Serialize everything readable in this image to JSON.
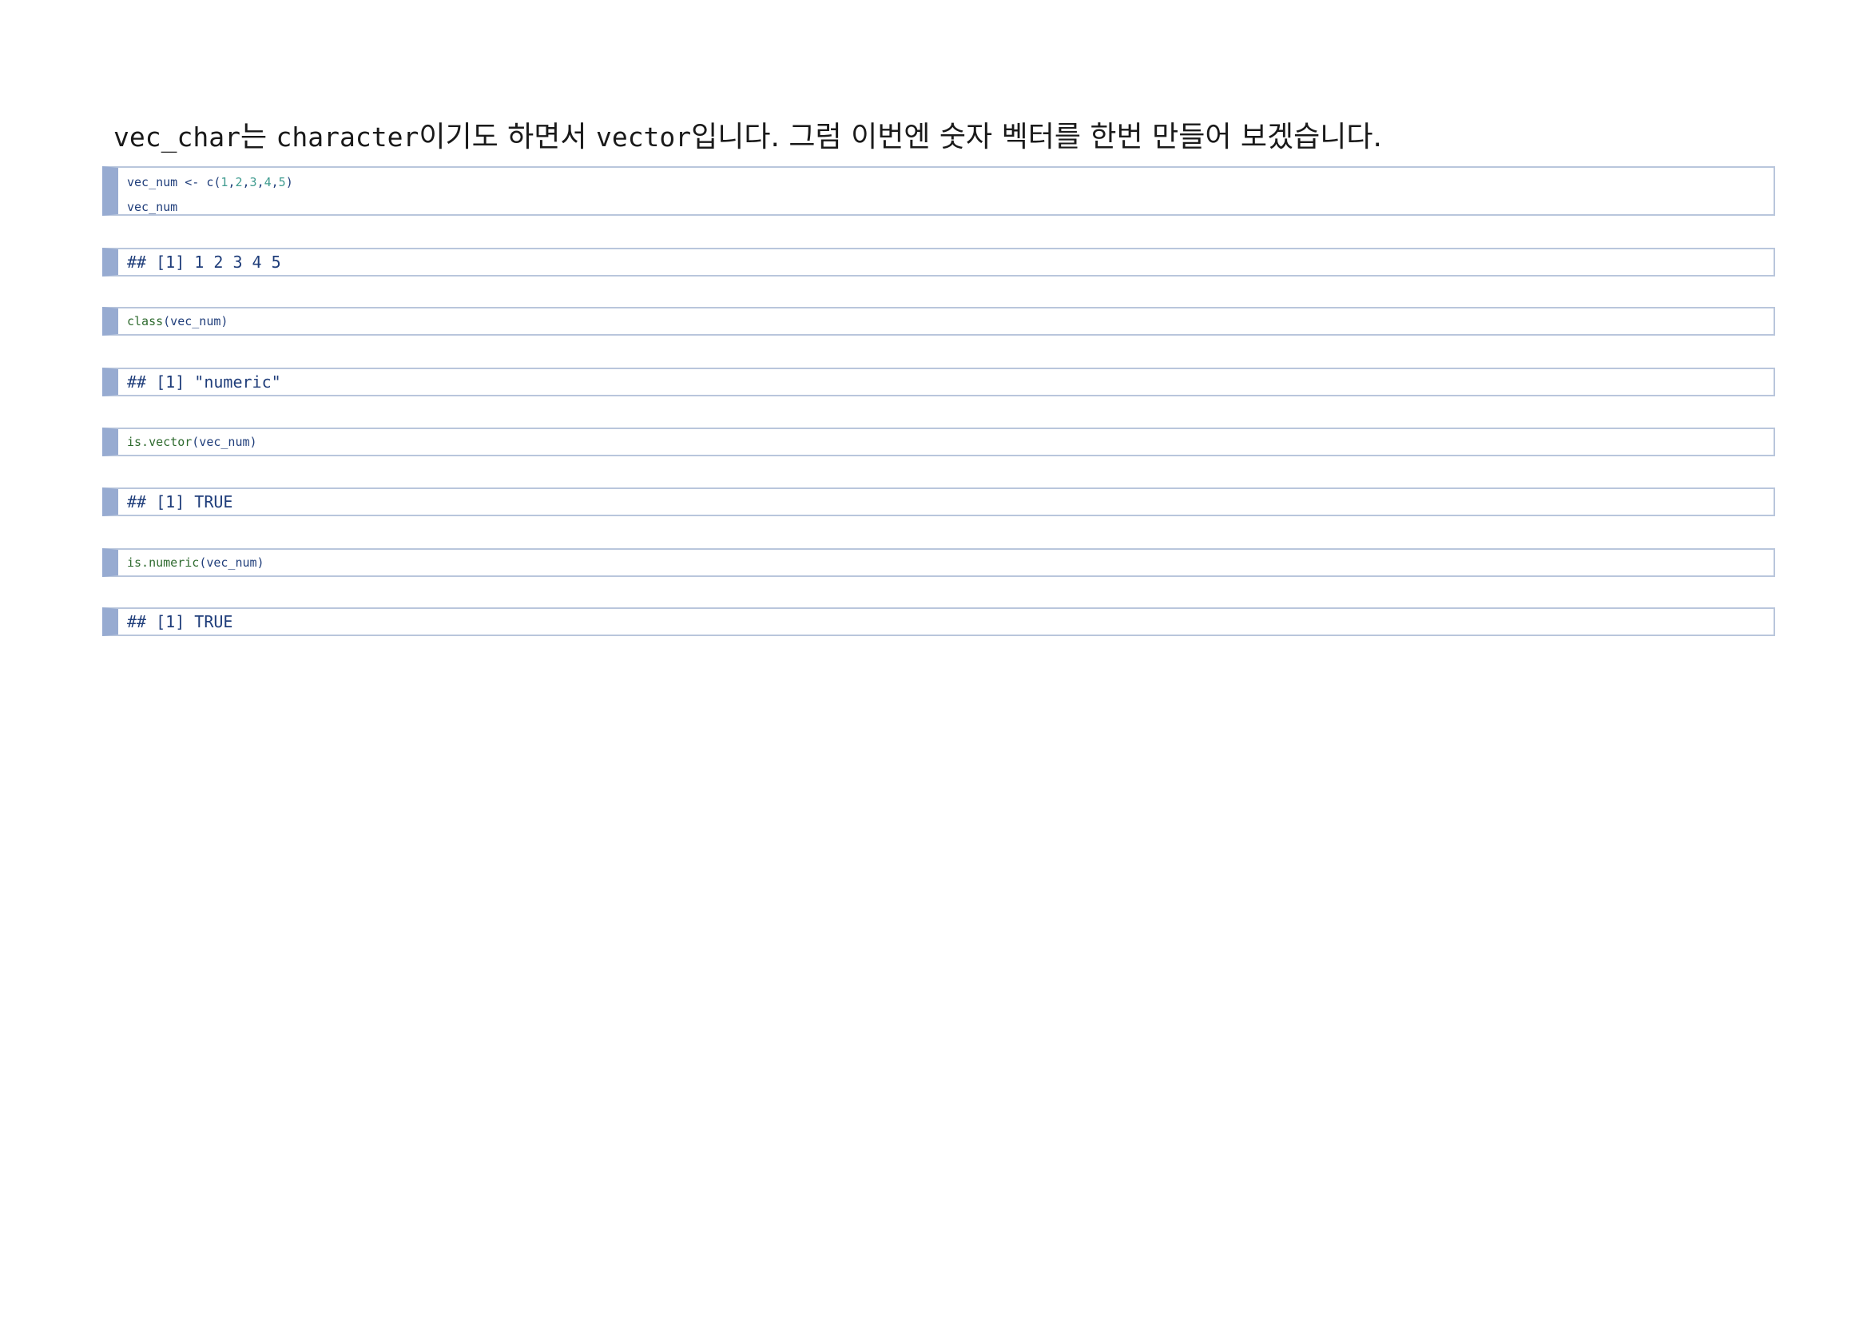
{
  "intro": {
    "part1_code": "vec_char",
    "part2": "는 ",
    "part3_code": "character",
    "part4": "이기도 하면서 ",
    "part5_code": "vector",
    "part6": "입니다. 그럼 이번엔 숫자 벡터를 한번 만들어 보겠습니다."
  },
  "blocks": [
    {
      "kind": "code",
      "line1": {
        "lhs": "vec_num <- c(",
        "n1": "1",
        "c1": ",",
        "n2": "2",
        "c2": ",",
        "n3": "3",
        "c3": ",",
        "n4": "4",
        "c4": ",",
        "n5": "5",
        "rhs": ")"
      },
      "line2": "vec_num"
    },
    {
      "kind": "output",
      "text": "## [1] 1 2 3 4 5"
    },
    {
      "kind": "code",
      "fn": "class",
      "args": "(vec_num)"
    },
    {
      "kind": "output",
      "text": "## [1] \"numeric\""
    },
    {
      "kind": "code",
      "fn": "is.vector",
      "args": "(vec_num)"
    },
    {
      "kind": "output",
      "text": "## [1] TRUE"
    },
    {
      "kind": "code",
      "fn": "is.numeric",
      "args": "(vec_num)"
    },
    {
      "kind": "output",
      "text": "## [1] TRUE"
    }
  ],
  "colors": {
    "block_accent": "#97abd1",
    "block_border": "#b9c6dc",
    "code_text": "#1f3d7a",
    "number_literal": "#3f9b8f",
    "function_call": "#2f6b2f"
  }
}
